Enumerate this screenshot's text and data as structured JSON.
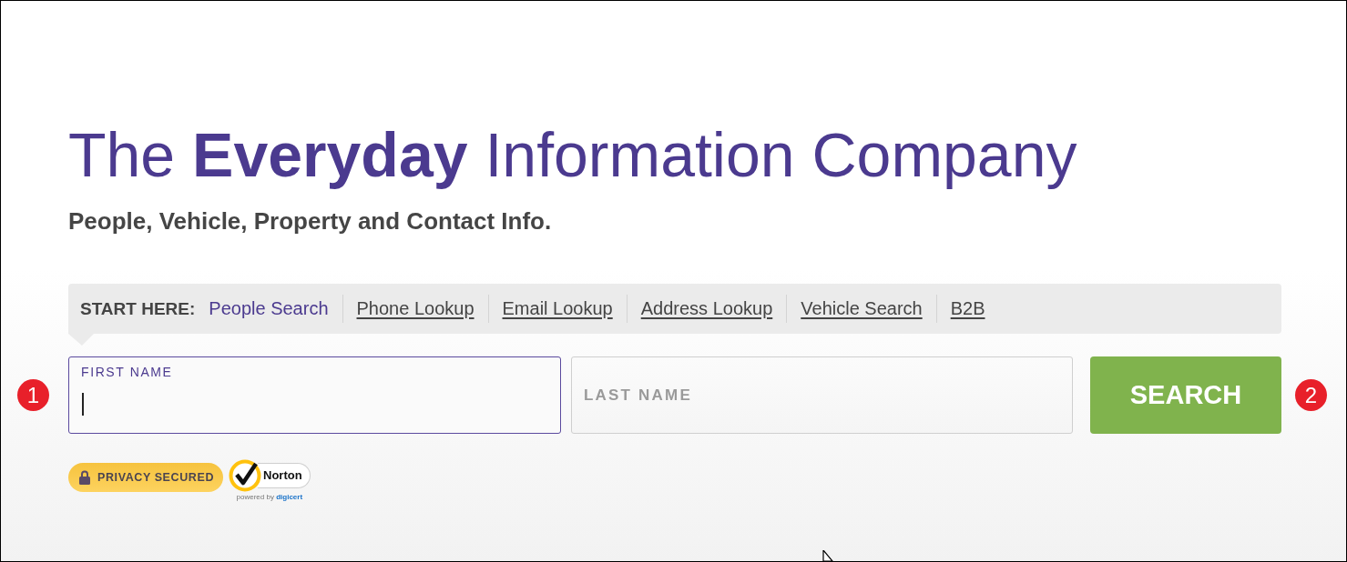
{
  "headline": "The **Everyday** Information Company",
  "subtitle": "People, Vehicle, Property and Contact Info.",
  "search_tabs": {
    "prompt": "START HERE:",
    "tabs": [
      {
        "label": "People Search",
        "selected": true
      },
      {
        "label": "Phone Lookup",
        "selected": false
      },
      {
        "label": "Email Lookup",
        "selected": false
      },
      {
        "label": "Address Lookup",
        "selected": false
      },
      {
        "label": "Vehicle Search",
        "selected": false
      },
      {
        "label": "B2B",
        "selected": false
      }
    ]
  },
  "fields": [
    {
      "label": "FIRST NAME",
      "focused": true
    },
    {
      "label": "LAST NAME",
      "focused": false
    }
  ],
  "search_button": {
    "label": "SEARCH"
  },
  "annotations": [
    {
      "label": "1"
    },
    {
      "label": "2"
    }
  ],
  "privacy_badge": {
    "label": "PRIVACY SECURED"
  },
  "norton_seal": {
    "name": "Norton",
    "powered_by": "powered by",
    "provider": "digicert"
  }
}
